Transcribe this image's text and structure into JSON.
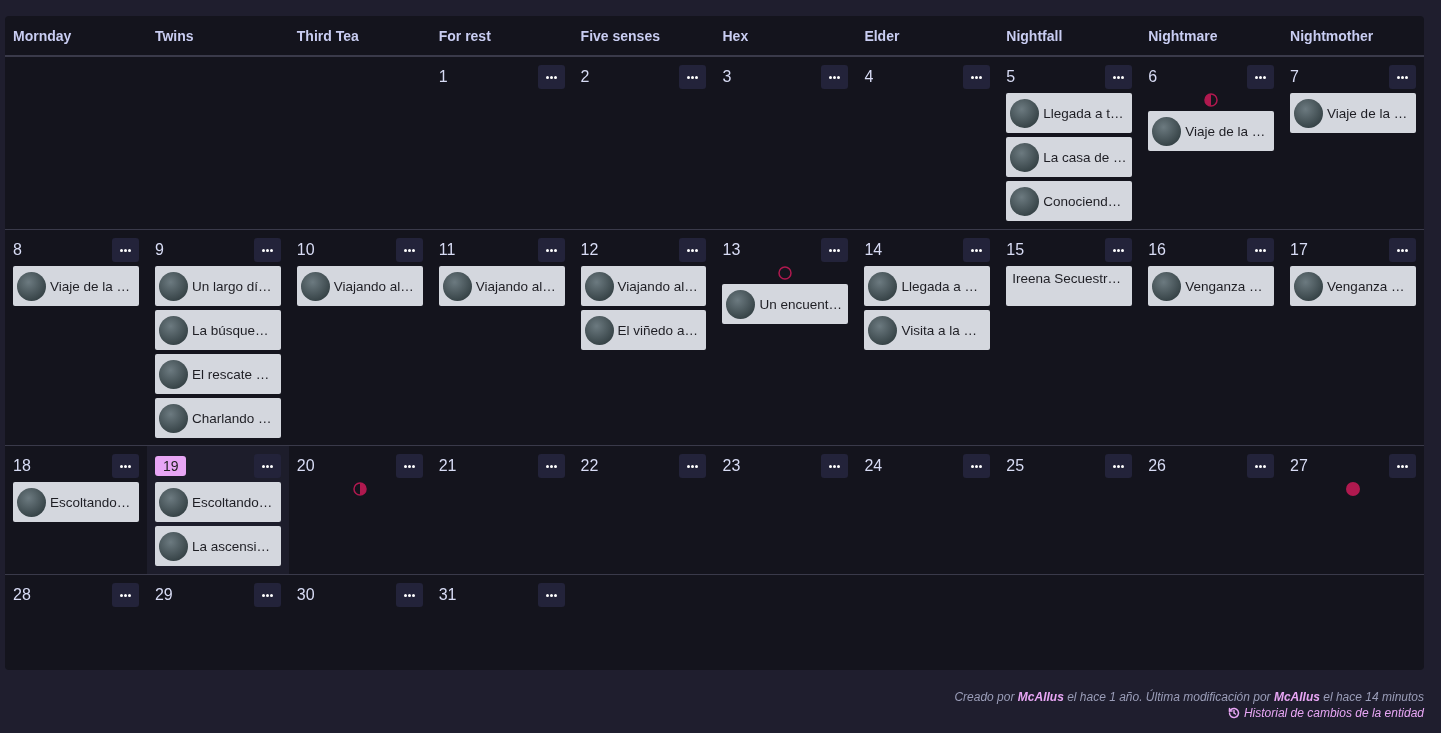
{
  "calendar": {
    "weekdays": [
      "Mornday",
      "Twins",
      "Third Tea",
      "For rest",
      "Five senses",
      "Hex",
      "Elder",
      "Nightfall",
      "Nightmare",
      "Nightmother"
    ],
    "weeks": [
      {
        "kind": "lead_in",
        "days": [
          {
            "number": "1",
            "today": false
          },
          {
            "number": "2",
            "today": false
          },
          {
            "number": "3",
            "today": false
          },
          {
            "number": "4",
            "today": false
          },
          {
            "number": "5",
            "today": false,
            "events": [
              {
                "title": "Llegada a t…",
                "avatar": true
              },
              {
                "title": "La casa de …",
                "avatar": true
              },
              {
                "title": "Conociend…",
                "avatar": true
              }
            ]
          },
          {
            "number": "6",
            "today": false,
            "moon": {
              "kind": "first_quarter"
            },
            "events": [
              {
                "title": "Viaje de la …",
                "avatar": true
              }
            ]
          },
          {
            "number": "7",
            "today": false,
            "events": [
              {
                "title": "Viaje de la …",
                "avatar": true
              }
            ]
          }
        ]
      },
      {
        "kind": "standard",
        "days": [
          {
            "number": "8",
            "today": false,
            "events": [
              {
                "title": "Viaje de la …",
                "avatar": true
              }
            ]
          },
          {
            "number": "9",
            "today": false,
            "events": [
              {
                "title": "Un largo dí…",
                "avatar": true
              },
              {
                "title": "La búsque…",
                "avatar": true
              },
              {
                "title": "El rescate …",
                "avatar": true
              },
              {
                "title": "Charlando …",
                "avatar": true
              }
            ]
          },
          {
            "number": "10",
            "today": false,
            "events": [
              {
                "title": "Viajando al…",
                "avatar": true
              }
            ]
          },
          {
            "number": "11",
            "today": false,
            "events": [
              {
                "title": "Viajando al…",
                "avatar": true
              }
            ]
          },
          {
            "number": "12",
            "today": false,
            "events": [
              {
                "title": "Viajando al…",
                "avatar": true
              },
              {
                "title": "El viñedo a…",
                "avatar": true
              }
            ]
          },
          {
            "number": "13",
            "today": false,
            "moon": {
              "kind": "new"
            },
            "events": [
              {
                "title": "Un encuent…",
                "avatar": true
              }
            ]
          },
          {
            "number": "14",
            "today": false,
            "events": [
              {
                "title": "Llegada a …",
                "avatar": true
              },
              {
                "title": "Visita a la …",
                "avatar": true
              }
            ]
          },
          {
            "number": "15",
            "today": false,
            "events": [
              {
                "title": "Ireena Secuestr…",
                "avatar": false
              }
            ]
          },
          {
            "number": "16",
            "today": false,
            "events": [
              {
                "title": "Venganza …",
                "avatar": true
              }
            ]
          },
          {
            "number": "17",
            "today": false,
            "events": [
              {
                "title": "Venganza …",
                "avatar": true
              }
            ]
          }
        ]
      },
      {
        "kind": "standard",
        "days": [
          {
            "number": "18",
            "today": false,
            "events": [
              {
                "title": "Escoltando…",
                "avatar": true
              }
            ]
          },
          {
            "number": "19",
            "today": true,
            "events": [
              {
                "title": "Escoltando…",
                "avatar": true
              },
              {
                "title": "La ascensi…",
                "avatar": true
              }
            ]
          },
          {
            "number": "20",
            "today": false,
            "moon": {
              "kind": "last_quarter"
            }
          },
          {
            "number": "21",
            "today": false
          },
          {
            "number": "22",
            "today": false
          },
          {
            "number": "23",
            "today": false
          },
          {
            "number": "24",
            "today": false
          },
          {
            "number": "25",
            "today": false
          },
          {
            "number": "26",
            "today": false
          },
          {
            "number": "27",
            "today": false,
            "moon": {
              "kind": "full"
            }
          }
        ]
      },
      {
        "kind": "standard",
        "days": [
          {
            "number": "28",
            "today": false
          },
          {
            "number": "29",
            "today": false
          },
          {
            "number": "30",
            "today": false
          },
          {
            "number": "31",
            "today": false
          }
        ]
      }
    ]
  },
  "footer": {
    "sentence": [
      {
        "kind": "text",
        "text": "Creado por "
      },
      {
        "kind": "link",
        "text": "McAllus"
      },
      {
        "kind": "text",
        "text": " el hace 1 año. Última modificación por "
      },
      {
        "kind": "link",
        "text": "McAllus"
      },
      {
        "kind": "text",
        "text": " el hace 14 minutos"
      }
    ],
    "history_link": "Historial de cambios de la entidad"
  }
}
